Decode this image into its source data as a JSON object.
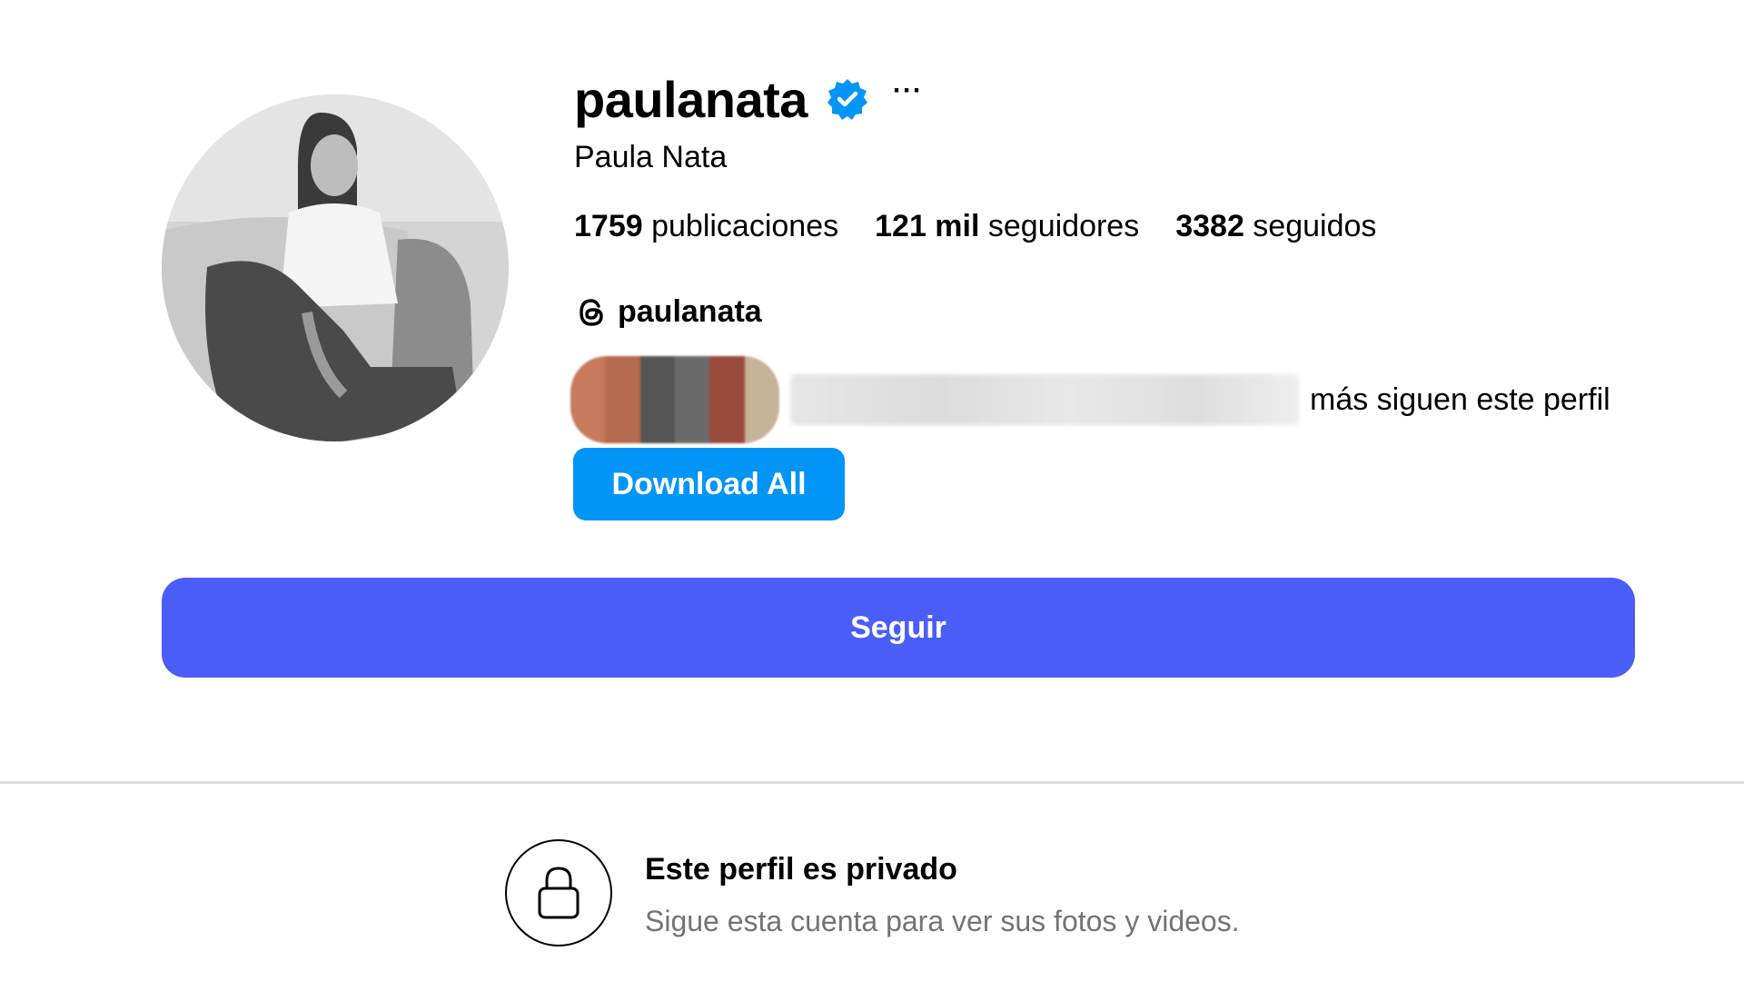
{
  "profile": {
    "username": "paulanata",
    "full_name": "Paula Nata",
    "more_options": "···"
  },
  "stats": {
    "posts_count": "1759",
    "posts_label": " publicaciones",
    "followers_count": "121 mil",
    "followers_label": " seguidores",
    "following_count": "3382",
    "following_label": " seguidos"
  },
  "threads": {
    "handle": "paulanata"
  },
  "followed_by": {
    "text": "más siguen este perfil"
  },
  "buttons": {
    "download_all": "Download All",
    "follow": "Seguir"
  },
  "private_notice": {
    "title": "Este perfil es privado",
    "subtitle": "Sigue esta cuenta para ver sus fotos y videos."
  },
  "colors": {
    "verified_badge": "#0095f6",
    "download_button": "#0095f6",
    "follow_button": "#4a5df9",
    "secondary_text": "#737373",
    "divider": "#dbdbdb"
  }
}
